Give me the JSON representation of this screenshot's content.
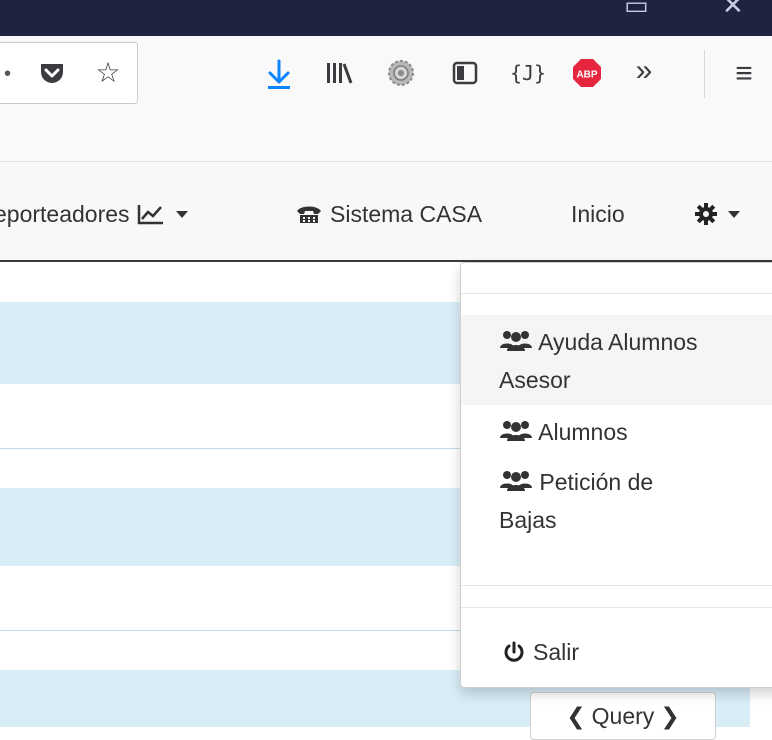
{
  "browser": {
    "icons": [
      "restore-icon",
      "close-icon",
      "pocket-icon",
      "star-icon",
      "download-icon",
      "library-icon",
      "extension-gear-icon",
      "sidebar-icon",
      "json-viewer-icon",
      "adblock-plus-icon",
      "overflow-chevrons-icon",
      "hamburger-menu-icon"
    ],
    "abp_label": "ABP",
    "json_label": "{J}",
    "accent_color": "#0a84ff",
    "abp_color": "#e6253f"
  },
  "navbar": {
    "reporteadores_label": "eporteadores",
    "sistema_label": "Sistema CASA",
    "inicio_label": "Inicio"
  },
  "dropdown": {
    "items": [
      {
        "label_line1": "Ayuda Alumnos",
        "label_line2": "Asesor",
        "icon": "users-icon"
      },
      {
        "label_line1": "Alumnos",
        "icon": "users-icon"
      },
      {
        "label_line1": "Petición de",
        "label_line2": "Bajas",
        "icon": "users-icon"
      }
    ],
    "logout_label": "Salir"
  },
  "query_button": {
    "label": "Query"
  },
  "colors": {
    "row_highlight": "#d9edf7",
    "navbar_bg": "#f8f8f8"
  }
}
